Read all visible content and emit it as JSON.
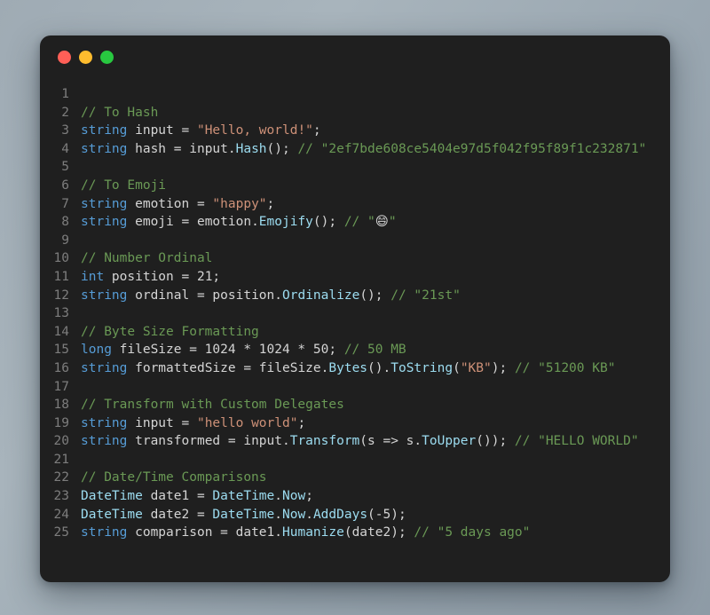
{
  "window": {
    "buttons": [
      {
        "name": "close",
        "label": "",
        "color": "#ff5f57"
      },
      {
        "name": "minimize",
        "label": "",
        "color": "#febc2e"
      },
      {
        "name": "maximize",
        "label": "",
        "color": "#28c840"
      }
    ]
  },
  "editor": {
    "language": "csharp",
    "background": "#1f1f1f",
    "colors": {
      "keyword": "#569cd6",
      "type": "#9cdcf0",
      "function": "#9cdcf0",
      "string": "#ce9178",
      "comment": "#6a9955",
      "plain": "#d4d4d4",
      "line_number": "#7d7d7d"
    },
    "lines": [
      {
        "n": "1",
        "tokens": []
      },
      {
        "n": "2",
        "tokens": [
          {
            "t": "com",
            "v": "// To Hash"
          }
        ]
      },
      {
        "n": "3",
        "tokens": [
          {
            "t": "kw",
            "v": "string"
          },
          {
            "t": "plain",
            "v": " input = "
          },
          {
            "t": "str",
            "v": "\"Hello, world!\""
          },
          {
            "t": "plain",
            "v": ";"
          }
        ]
      },
      {
        "n": "4",
        "tokens": [
          {
            "t": "kw",
            "v": "string"
          },
          {
            "t": "plain",
            "v": " hash = input."
          },
          {
            "t": "fn",
            "v": "Hash"
          },
          {
            "t": "plain",
            "v": "(); "
          },
          {
            "t": "com",
            "v": "// \"2ef7bde608ce5404e97d5f042f95f89f1c232871\""
          }
        ]
      },
      {
        "n": "5",
        "tokens": []
      },
      {
        "n": "6",
        "tokens": [
          {
            "t": "com",
            "v": "// To Emoji"
          }
        ]
      },
      {
        "n": "7",
        "tokens": [
          {
            "t": "kw",
            "v": "string"
          },
          {
            "t": "plain",
            "v": " emotion = "
          },
          {
            "t": "str",
            "v": "\"happy\""
          },
          {
            "t": "plain",
            "v": ";"
          }
        ]
      },
      {
        "n": "8",
        "tokens": [
          {
            "t": "kw",
            "v": "string"
          },
          {
            "t": "plain",
            "v": " emoji = emotion."
          },
          {
            "t": "fn",
            "v": "Emojify"
          },
          {
            "t": "plain",
            "v": "(); "
          },
          {
            "t": "com",
            "v": "// \""
          },
          {
            "t": "emoji",
            "v": "😄"
          },
          {
            "t": "com",
            "v": "\""
          }
        ]
      },
      {
        "n": "9",
        "tokens": []
      },
      {
        "n": "10",
        "tokens": [
          {
            "t": "com",
            "v": "// Number Ordinal"
          }
        ]
      },
      {
        "n": "11",
        "tokens": [
          {
            "t": "kw",
            "v": "int"
          },
          {
            "t": "plain",
            "v": " position = 21;"
          }
        ]
      },
      {
        "n": "12",
        "tokens": [
          {
            "t": "kw",
            "v": "string"
          },
          {
            "t": "plain",
            "v": " ordinal = position."
          },
          {
            "t": "fn",
            "v": "Ordinalize"
          },
          {
            "t": "plain",
            "v": "(); "
          },
          {
            "t": "com",
            "v": "// \"21st\""
          }
        ]
      },
      {
        "n": "13",
        "tokens": []
      },
      {
        "n": "14",
        "tokens": [
          {
            "t": "com",
            "v": "// Byte Size Formatting"
          }
        ]
      },
      {
        "n": "15",
        "tokens": [
          {
            "t": "kw",
            "v": "long"
          },
          {
            "t": "plain",
            "v": " fileSize = 1024 * 1024 * 50; "
          },
          {
            "t": "com",
            "v": "// 50 MB"
          }
        ]
      },
      {
        "n": "16",
        "tokens": [
          {
            "t": "kw",
            "v": "string"
          },
          {
            "t": "plain",
            "v": " formattedSize = fileSize."
          },
          {
            "t": "fn",
            "v": "Bytes"
          },
          {
            "t": "plain",
            "v": "()."
          },
          {
            "t": "fn",
            "v": "ToString"
          },
          {
            "t": "plain",
            "v": "("
          },
          {
            "t": "str",
            "v": "\"KB\""
          },
          {
            "t": "plain",
            "v": "); "
          },
          {
            "t": "com",
            "v": "// \"51200 KB\""
          }
        ]
      },
      {
        "n": "17",
        "tokens": []
      },
      {
        "n": "18",
        "tokens": [
          {
            "t": "com",
            "v": "// Transform with Custom Delegates"
          }
        ]
      },
      {
        "n": "19",
        "tokens": [
          {
            "t": "kw",
            "v": "string"
          },
          {
            "t": "plain",
            "v": " input = "
          },
          {
            "t": "str",
            "v": "\"hello world\""
          },
          {
            "t": "plain",
            "v": ";"
          }
        ]
      },
      {
        "n": "20",
        "tokens": [
          {
            "t": "kw",
            "v": "string"
          },
          {
            "t": "plain",
            "v": " transformed = input."
          },
          {
            "t": "fn",
            "v": "Transform"
          },
          {
            "t": "plain",
            "v": "(s => s."
          },
          {
            "t": "fn",
            "v": "ToUpper"
          },
          {
            "t": "plain",
            "v": "()); "
          },
          {
            "t": "com",
            "v": "// \"HELLO WORLD\""
          }
        ]
      },
      {
        "n": "21",
        "tokens": []
      },
      {
        "n": "22",
        "tokens": [
          {
            "t": "com",
            "v": "// Date/Time Comparisons"
          }
        ]
      },
      {
        "n": "23",
        "tokens": [
          {
            "t": "type",
            "v": "DateTime"
          },
          {
            "t": "plain",
            "v": " date1 = "
          },
          {
            "t": "type",
            "v": "DateTime"
          },
          {
            "t": "plain",
            "v": "."
          },
          {
            "t": "fn",
            "v": "Now"
          },
          {
            "t": "plain",
            "v": ";"
          }
        ]
      },
      {
        "n": "24",
        "tokens": [
          {
            "t": "type",
            "v": "DateTime"
          },
          {
            "t": "plain",
            "v": " date2 = "
          },
          {
            "t": "type",
            "v": "DateTime"
          },
          {
            "t": "plain",
            "v": "."
          },
          {
            "t": "fn",
            "v": "Now"
          },
          {
            "t": "plain",
            "v": "."
          },
          {
            "t": "fn",
            "v": "AddDays"
          },
          {
            "t": "plain",
            "v": "(-5);"
          }
        ]
      },
      {
        "n": "25",
        "tokens": [
          {
            "t": "kw",
            "v": "string"
          },
          {
            "t": "plain",
            "v": " comparison = date1."
          },
          {
            "t": "fn",
            "v": "Humanize"
          },
          {
            "t": "plain",
            "v": "(date2); "
          },
          {
            "t": "com",
            "v": "// \"5 days ago\""
          }
        ]
      }
    ]
  }
}
